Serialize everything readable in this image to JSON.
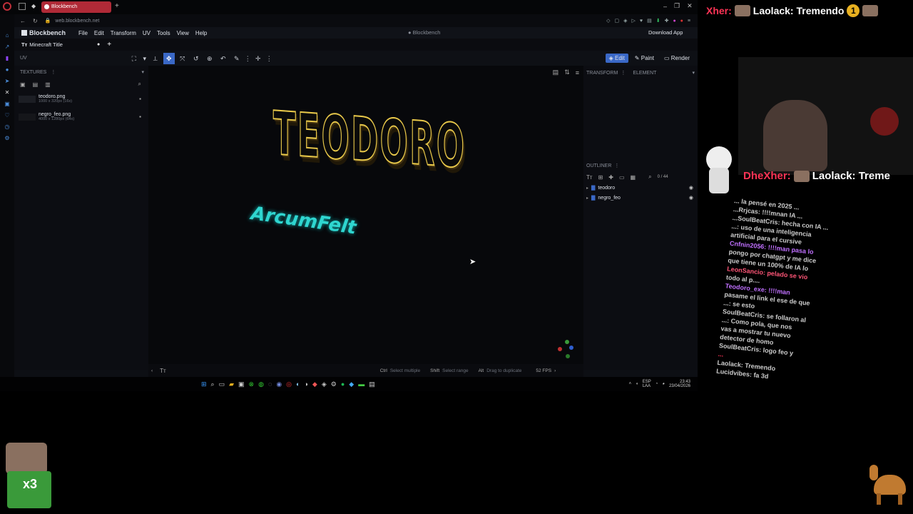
{
  "browser": {
    "tab_title": "Blockbench",
    "url": "web.blockbench.net"
  },
  "app": {
    "name": "Blockbench",
    "center_title": "● Blockbench",
    "download": "Download App",
    "menu": [
      "File",
      "Edit",
      "Transform",
      "UV",
      "Tools",
      "View",
      "Help"
    ],
    "project_tab": "Minecraft Title",
    "modes": [
      "Edit",
      "Paint",
      "Render"
    ]
  },
  "left_panel": {
    "uv_label": "UV",
    "textures_label": "TEXTURES",
    "textures": [
      {
        "name": "teodoro.png",
        "meta": "1000 x 320px (16x)"
      },
      {
        "name": "negro_feo.png",
        "meta": "4000 x 1280px (64x)"
      }
    ]
  },
  "viewport": {
    "title_text": "TEODORO",
    "subtitle_text": "ArcumFelt"
  },
  "right_panel": {
    "transform_label": "TRANSFORM",
    "element_label": "ELEMENT",
    "outliner_label": "OUTLINER",
    "outliner_count": "0 / 44",
    "items": [
      "teodoro",
      "negro_feo"
    ]
  },
  "status": {
    "ctrl_key": "Ctrl",
    "ctrl_hint": "Select multiple",
    "shift_key": "Shift",
    "shift_hint": "Select range",
    "alt_key": "Alt",
    "alt_hint": "Drag to duplicate",
    "fps": "52 FPS"
  },
  "taskbar": {
    "lang": "ESP",
    "lang2": "LAA",
    "time": "23:43",
    "date": "23/04/2026"
  },
  "overlay": {
    "top_banner_a": "Xher:",
    "top_banner_b": "Laolack: Tremendo",
    "badge": "1",
    "mid_banner_a": "DheXher:",
    "mid_banner_b": "Laolack: Treme",
    "chat_lines": [
      "... la pensé en 2025 ...",
      "...Rrjcas: !!!!mnan IA ...",
      "...SoulBeatCris: hecha con IA ...",
      "...: uso de una inteligencia",
      "artificial para el cursive",
      "Cnfnin2056: !!!!man pasa lo",
      "pongo por chatgpt y me dice",
      "que tiene un 100% de IA lo",
      "LeonSancio: pelado se vio",
      "todo al p....",
      "Teodoro_exe: !!!!man",
      "pasame el link el ese de que",
      "...: se esto",
      "SoulBeatCris: se follaron al",
      "...: Como pola, que nos",
      "vas a mostrar tu nuevo",
      "detector de homo",
      "SoulBeatCris: logo feo y",
      "...",
      "Laolack: Tremendo",
      "Lucidvibes: fa 3d"
    ],
    "counter": "x3"
  }
}
